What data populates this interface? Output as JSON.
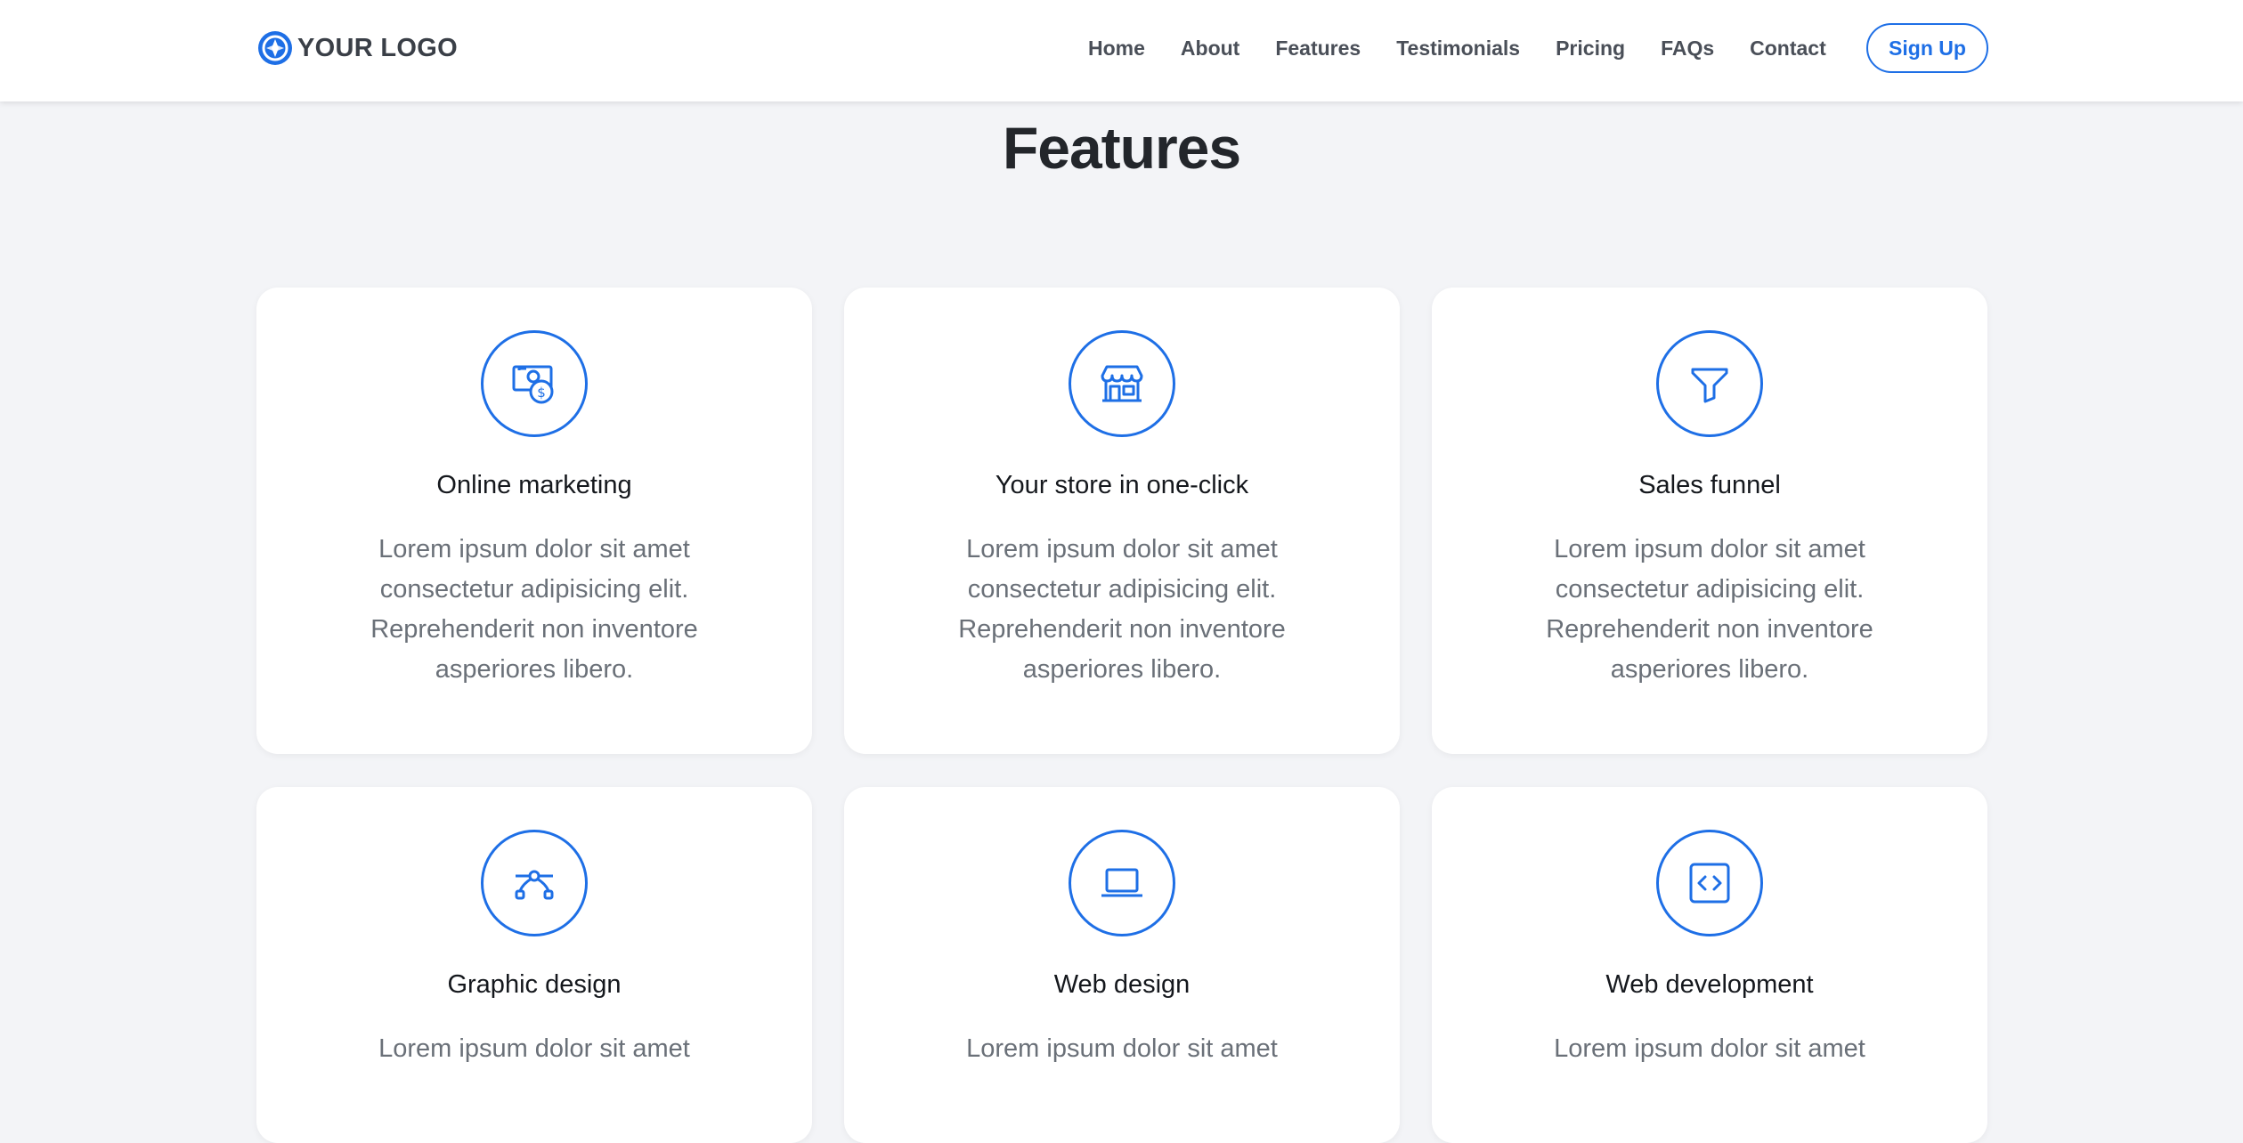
{
  "header": {
    "logo_text": "YOUR LOGO",
    "nav": [
      "Home",
      "About",
      "Features",
      "Testimonials",
      "Pricing",
      "FAQs",
      "Contact"
    ],
    "signup_label": "Sign Up"
  },
  "colors": {
    "accent": "#1e6fe6",
    "background": "#f3f4f7",
    "card": "#ffffff",
    "title": "#23262b",
    "body_text": "#6a7078"
  },
  "features": {
    "title": "Features",
    "cards": [
      {
        "icon": "cash-coin-icon",
        "title": "Online marketing",
        "text": "Lorem ipsum dolor sit amet consectetur adipisicing elit. Reprehenderit non inventore asperiores libero."
      },
      {
        "icon": "shop-icon",
        "title": "Your store in one-click",
        "text": "Lorem ipsum dolor sit amet consectetur adipisicing elit. Reprehenderit non inventore asperiores libero."
      },
      {
        "icon": "funnel-icon",
        "title": "Sales funnel",
        "text": "Lorem ipsum dolor sit amet consectetur adipisicing elit. Reprehenderit non inventore asperiores libero."
      },
      {
        "icon": "bezier-icon",
        "title": "Graphic design",
        "text": "Lorem ipsum dolor sit amet"
      },
      {
        "icon": "laptop-icon",
        "title": "Web design",
        "text": "Lorem ipsum dolor sit amet"
      },
      {
        "icon": "code-square-icon",
        "title": "Web development",
        "text": "Lorem ipsum dolor sit amet"
      }
    ]
  }
}
